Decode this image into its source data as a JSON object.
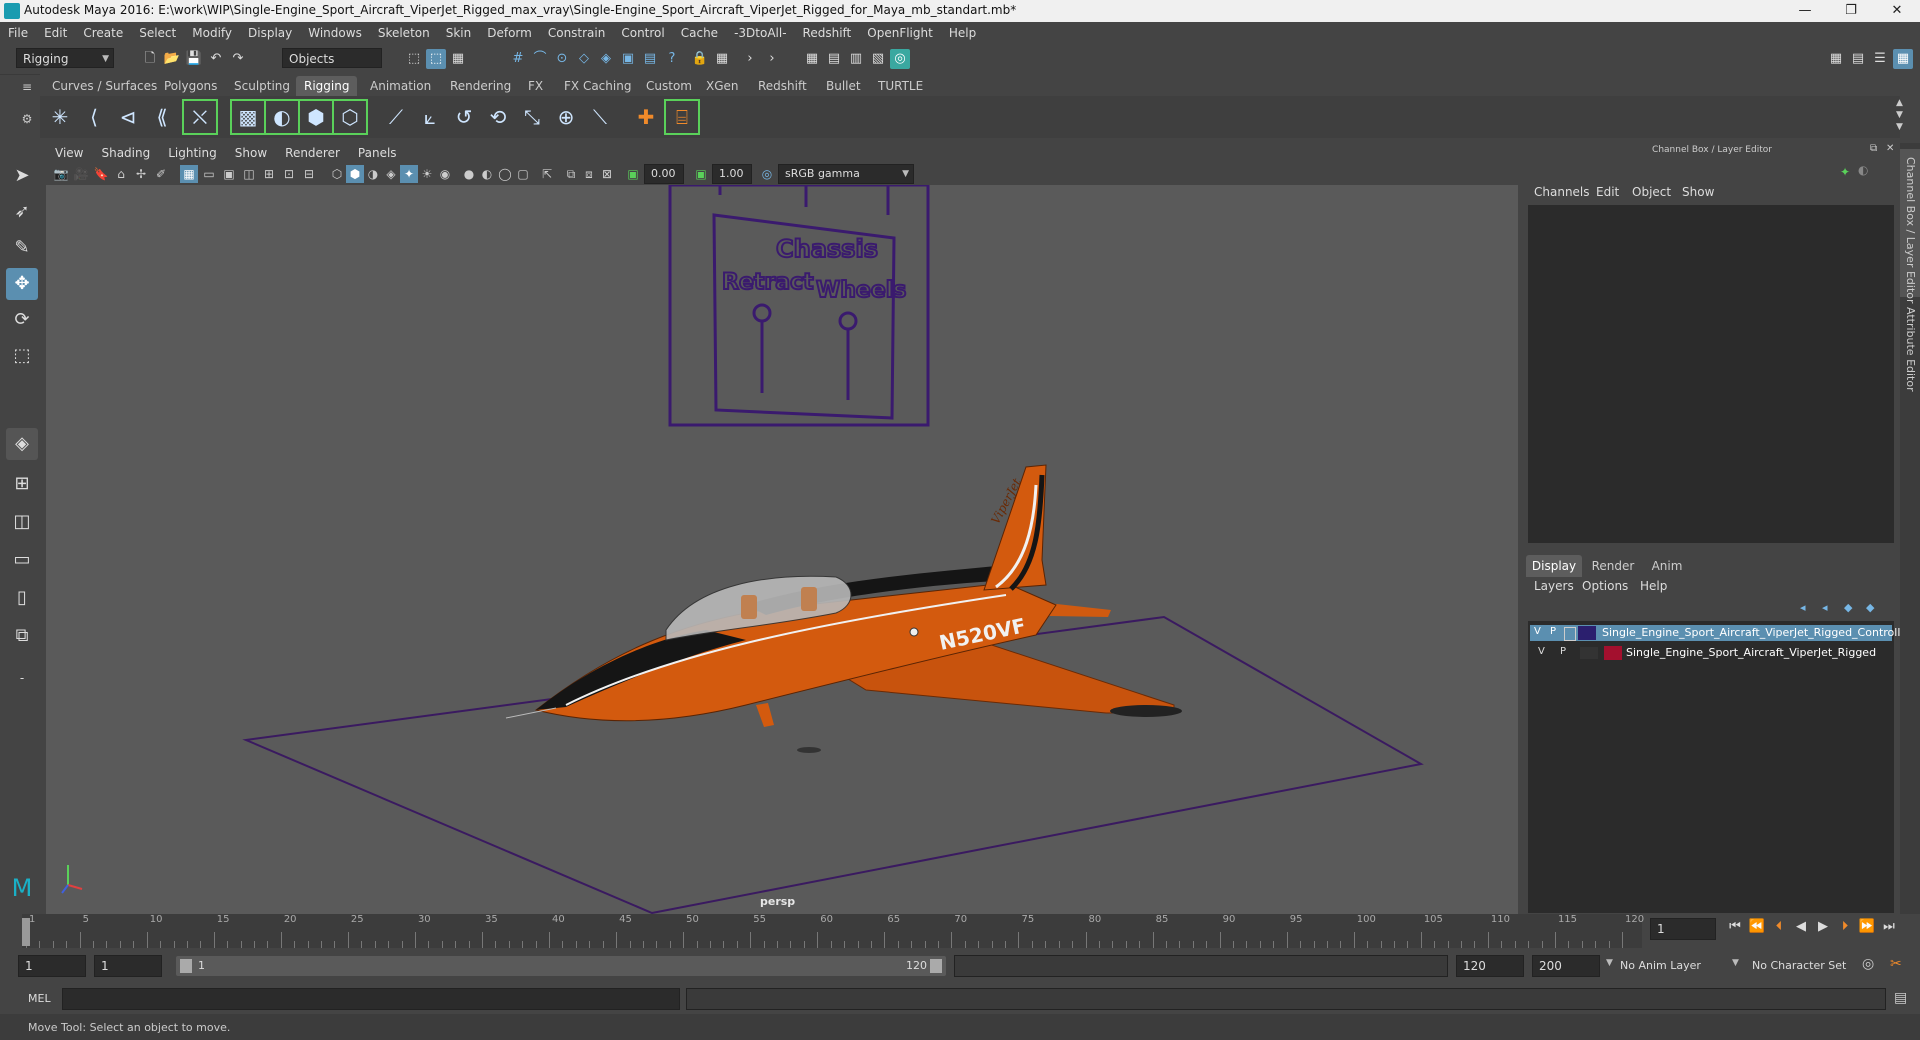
{
  "window": {
    "title": "Autodesk Maya 2016: E:\\work\\WIP\\Single-Engine_Sport_Aircraft_ViperJet_Rigged_max_vray\\Single-Engine_Sport_Aircraft_ViperJet_Rigged_for_Maya_mb_standart.mb*",
    "minimize": "—",
    "restore": "❐",
    "close": "✕"
  },
  "menu": [
    "File",
    "Edit",
    "Create",
    "Select",
    "Modify",
    "Display",
    "Windows",
    "Skeleton",
    "Skin",
    "Deform",
    "Constrain",
    "Control",
    "Cache",
    "-3DtoAll-",
    "Redshift",
    "OpenFlight",
    "Help"
  ],
  "status_line": {
    "mode": "Rigging",
    "selection_mode": "Objects"
  },
  "shelf_tabs": [
    "Curves / Surfaces",
    "Polygons",
    "Sculpting",
    "Rigging",
    "Animation",
    "Rendering",
    "FX",
    "FX Caching",
    "Custom",
    "XGen",
    "Redshift",
    "Bullet",
    "TURTLE"
  ],
  "shelf_active": "Rigging",
  "viewport": {
    "menu": [
      "View",
      "Shading",
      "Lighting",
      "Show",
      "Renderer",
      "Panels"
    ],
    "exposure": "0.00",
    "gamma": "1.00",
    "color_space": "sRGB gamma",
    "camera_label": "persp",
    "board_title": "Chassis",
    "board_left": "Retract",
    "board_right": "Wheels",
    "tail_number": "N520VF",
    "tail_script": "ViperJet"
  },
  "channel_box": {
    "title": "Channel Box / Layer Editor",
    "menu": [
      "Channels",
      "Edit",
      "Object",
      "Show"
    ]
  },
  "layer_editor": {
    "tabs": [
      "Display",
      "Render",
      "Anim"
    ],
    "active_tab": "Display",
    "menu": [
      "Layers",
      "Options",
      "Help"
    ],
    "layers": [
      {
        "v": "V",
        "p": "P",
        "color": "#2b1f6e",
        "name": "Single_Engine_Sport_Aircraft_ViperJet_Rigged_Controlle",
        "selected": true
      },
      {
        "v": "V",
        "p": "P",
        "color": "#a3102e",
        "name": "Single_Engine_Sport_Aircraft_ViperJet_Rigged",
        "selected": false
      }
    ]
  },
  "side_tabs": [
    "Channel Box / Layer Editor",
    "Attribute Editor"
  ],
  "timeline": {
    "ticks": [
      "1",
      "5",
      "10",
      "15",
      "20",
      "25",
      "30",
      "35",
      "40",
      "45",
      "50",
      "55",
      "60",
      "65",
      "70",
      "75",
      "80",
      "85",
      "90",
      "95",
      "100",
      "105",
      "110",
      "115",
      "120"
    ],
    "current_frame": "1"
  },
  "range": {
    "start": "1",
    "anim_start": "1",
    "slider_start": "1",
    "slider_end": "120",
    "end": "120",
    "anim_end": "200",
    "anim_layer": "No Anim Layer",
    "character_set": "No Character Set"
  },
  "command_line": {
    "label": "MEL"
  },
  "help_line": "Move Tool: Select an object to move."
}
